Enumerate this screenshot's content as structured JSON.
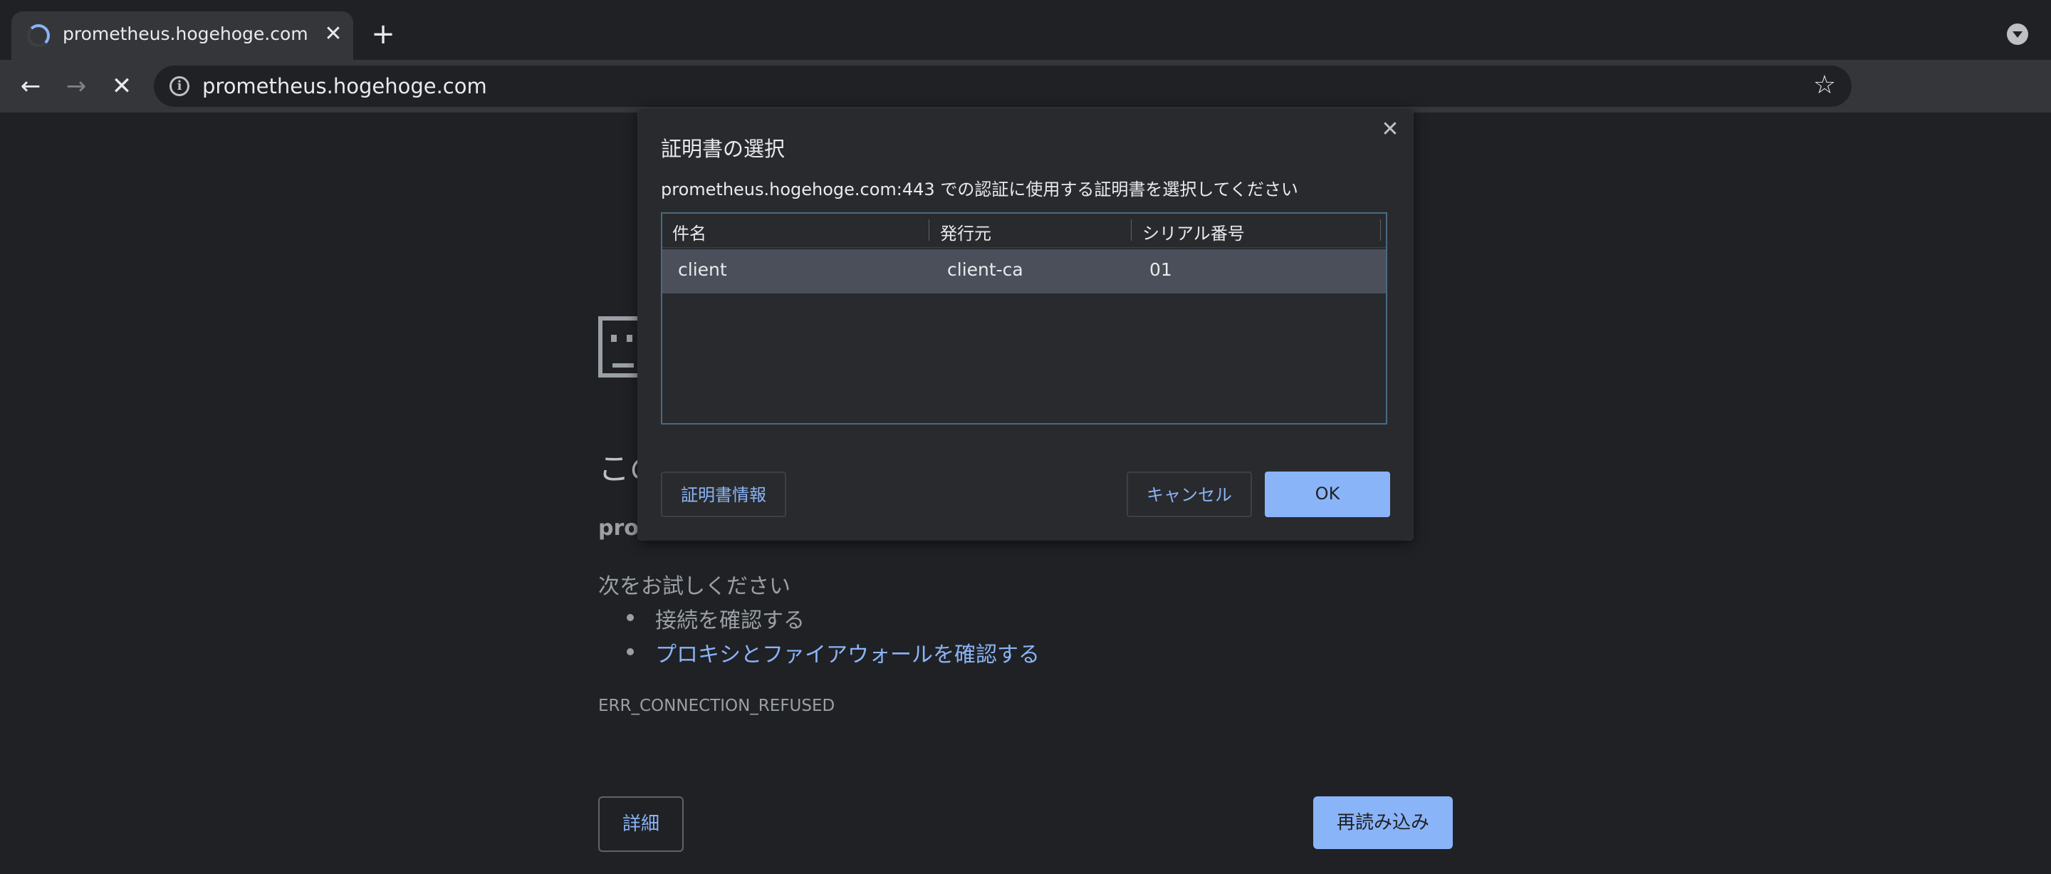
{
  "browser": {
    "tab": {
      "title": "prometheus.hogehoge.com",
      "close_glyph": "✕",
      "icon": "loading-spinner"
    },
    "new_tab_glyph": "+",
    "tab_search_icon": "chevron-down-circle-icon",
    "toolbar": {
      "back_glyph": "←",
      "forward_glyph": "→",
      "stop_glyph": "✕",
      "site_info_glyph": "i",
      "url": "prometheus.hogehoge.com",
      "bookmark_glyph": "☆"
    }
  },
  "error_page": {
    "heading": "この",
    "host": "prom",
    "try_label": "次をお試しください",
    "suggestions": [
      {
        "text": "接続を確認する",
        "link": false
      },
      {
        "text": "プロキシとファイアウォールを確認する",
        "link": true
      }
    ],
    "error_code": "ERR_CONNECTION_REFUSED",
    "details_button": "詳細",
    "reload_button": "再読み込み"
  },
  "dialog": {
    "title": "証明書の選択",
    "close_glyph": "✕",
    "message": "prometheus.hogehoge.com:443 での認証に使用する証明書を選択してください",
    "columns": [
      "件名",
      "発行元",
      "シリアル番号"
    ],
    "rows": [
      {
        "subject": "client",
        "issuer": "client-ca",
        "serial": "01",
        "selected": true
      }
    ],
    "cert_info_button": "証明書情報",
    "cancel_button": "キャンセル",
    "ok_button": "OK"
  },
  "colors": {
    "background": "#202124",
    "toolbar": "#35363a",
    "accent": "#8ab4f8",
    "dialog": "#292a2d",
    "selected_row": "#4a4f5a"
  }
}
